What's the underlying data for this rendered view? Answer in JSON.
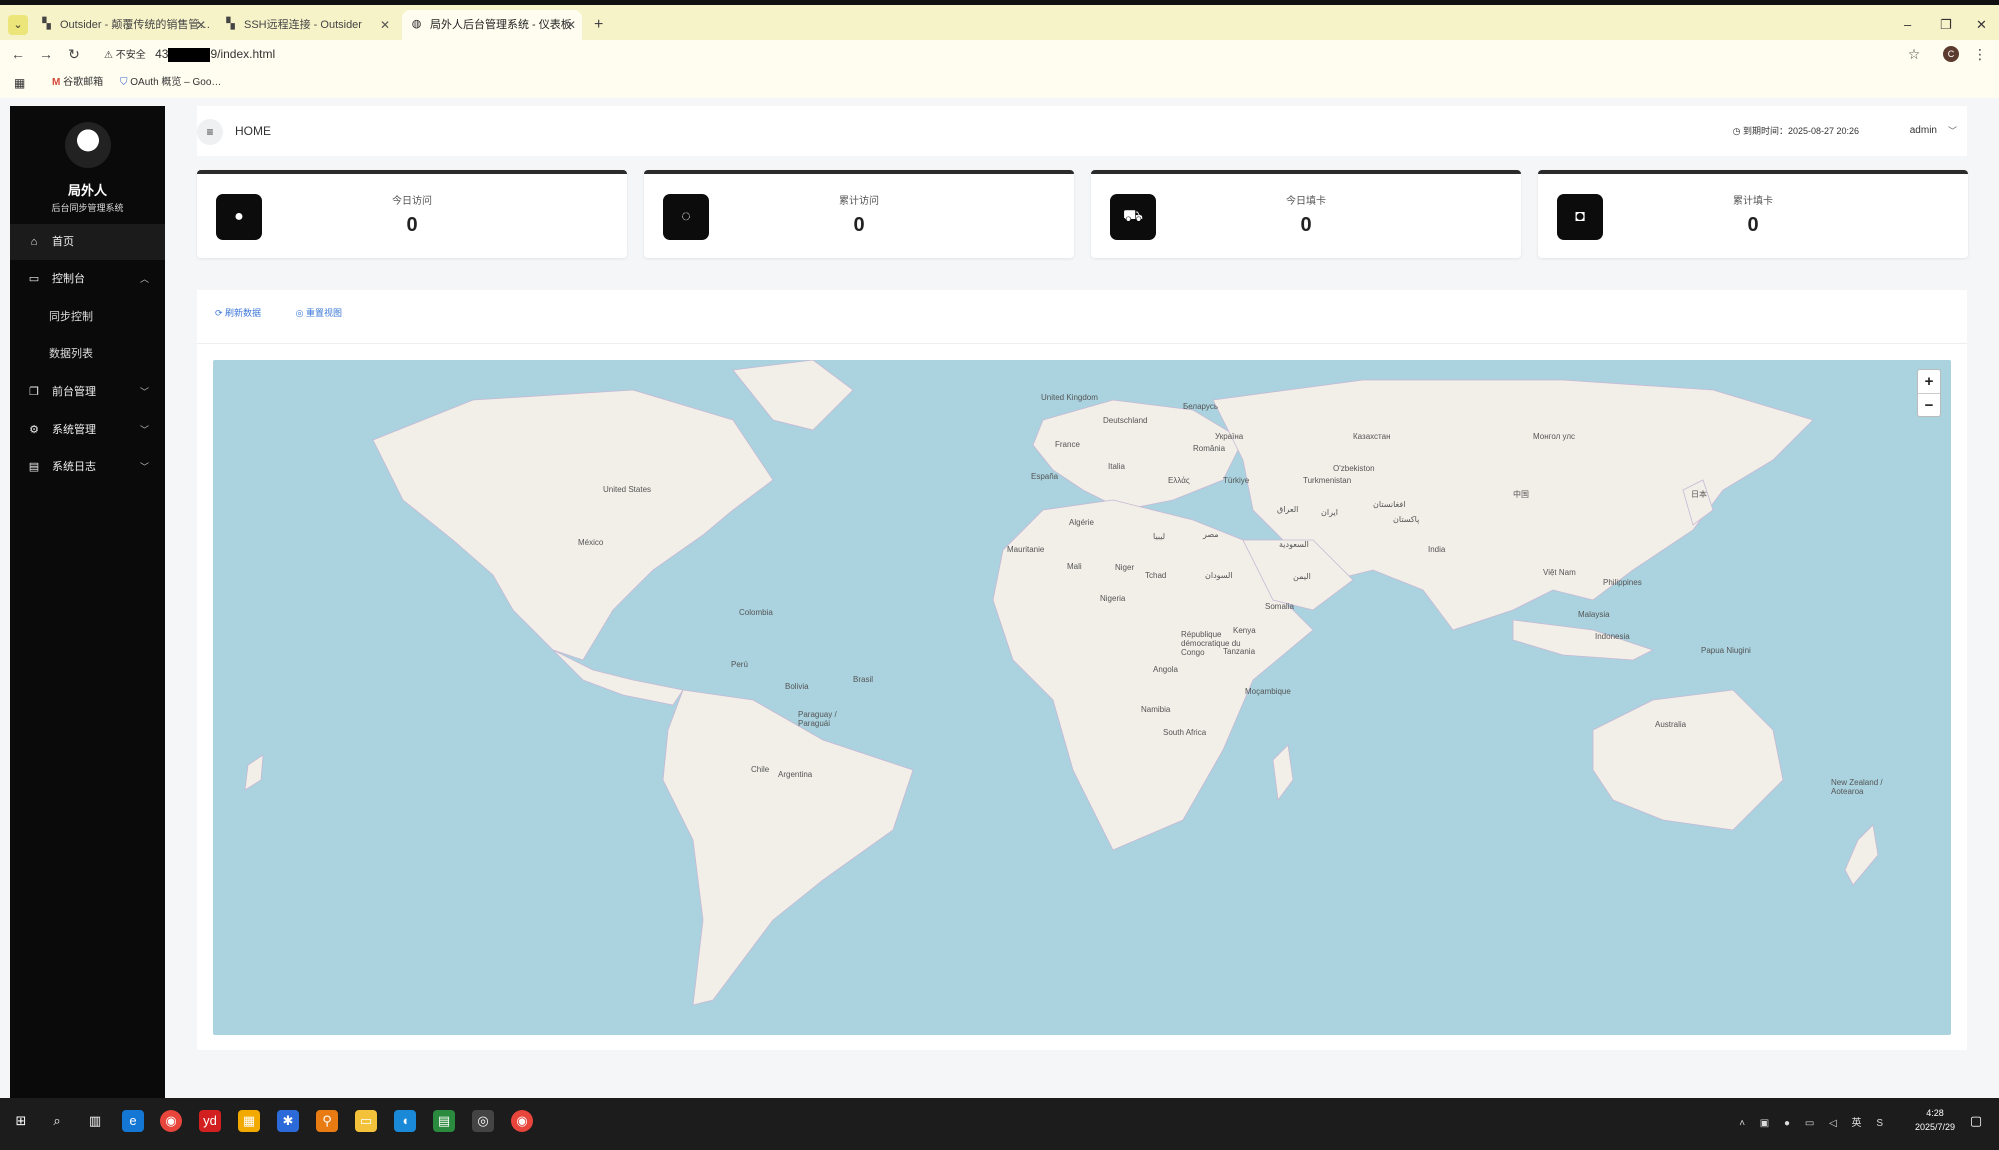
{
  "browser": {
    "tabs": [
      {
        "title": "Outsider - 颠覆传统的销售管…"
      },
      {
        "title": "SSH远程连接 - Outsider"
      },
      {
        "title": "局外人后台管理系统 - 仪表板"
      }
    ],
    "url_prefix": "43",
    "url_suffix": "9/index.html",
    "security_label": "不安全",
    "bookmarks": [
      "谷歌邮箱",
      "OAuth 概览 – Goo…"
    ],
    "profile_initial": "C"
  },
  "sidebar": {
    "name": "局外人",
    "subtitle": "后台同步管理系统",
    "items": [
      {
        "label": "首页",
        "icon": "home-icon"
      },
      {
        "label": "控制台",
        "icon": "monitor-icon"
      },
      {
        "label": "同步控制"
      },
      {
        "label": "数据列表"
      },
      {
        "label": "前台管理",
        "icon": "copy-icon"
      },
      {
        "label": "系统管理",
        "icon": "gear-icon"
      },
      {
        "label": "系统日志",
        "icon": "document-icon"
      }
    ]
  },
  "topbar": {
    "breadcrumb": "HOME",
    "expire_label": "到期时间：2025-08-27 20:26",
    "user": "admin"
  },
  "cards": [
    {
      "label": "今日访问",
      "value": "0",
      "icon": "user-icon"
    },
    {
      "label": "累计访问",
      "value": "0",
      "icon": "chat-icon"
    },
    {
      "label": "今日填卡",
      "value": "0",
      "icon": "cart-icon"
    },
    {
      "label": "累计填卡",
      "value": "0",
      "icon": "bag-icon"
    }
  ],
  "panel": {
    "refresh_label": "刷新数据",
    "reset_label": "重置视图"
  },
  "map": {
    "zoom_in": "+",
    "zoom_out": "−",
    "labels": [
      "United Kingdom",
      "Deutschland",
      "France",
      "España",
      "Italia",
      "Беларусь",
      "Україна",
      "România",
      "Türkiye",
      "Ελλάς",
      "Казахстан",
      "O'zbekiston",
      "Turkmenistan",
      "Монгол улс",
      "中国",
      "日本",
      "India",
      "Việt Nam",
      "Philippines",
      "Malaysia",
      "Indonesia",
      "Papua Niugini",
      "Australia",
      "New Zealand / Aotearoa",
      "United States",
      "México",
      "Colombia",
      "Perú",
      "Brasil",
      "Bolivia",
      "Paraguay / Paraguái",
      "Chile",
      "Argentina",
      "Algérie",
      "Mauritanie",
      "Mali",
      "Niger",
      "Tchad",
      "Nigeria",
      "Kenya",
      "Tanzania",
      "Angola",
      "Namibia",
      "South Africa",
      "Moçambique",
      "République démocratique du Congo",
      "Somalia",
      "مصر",
      "ليبيا",
      "السودان",
      "السعودية",
      "اليمن",
      "العراق",
      "ایران",
      "افغانستان",
      "پاکستان"
    ],
    "colors": {
      "ocean": "#aad3df",
      "land": "#f2efe9",
      "border": "#b9a9c9"
    }
  },
  "taskbar": {
    "time": "4:28",
    "date": "2025/7/29",
    "ime": "英"
  }
}
